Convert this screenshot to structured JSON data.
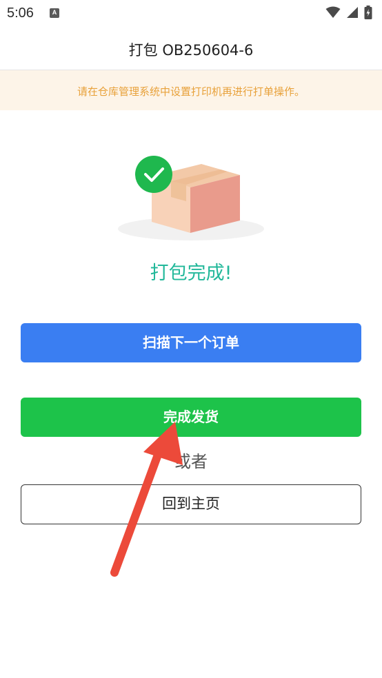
{
  "status": {
    "time": "5:06",
    "notification_icon": "A",
    "icons": [
      "wifi-icon",
      "signal-icon",
      "battery-charging-icon"
    ]
  },
  "header": {
    "title": "打包 OB250604-6"
  },
  "notice": {
    "text": "请在仓库管理系统中设置打印机再进行打单操作。",
    "color": "#e8a13a",
    "background": "#fdf4e8"
  },
  "result": {
    "illustration": "package-done-icon",
    "text": "打包完成!"
  },
  "actions": {
    "scan_next_label": "扫描下一个订单",
    "finish_ship_label": "完成发货",
    "or_label": "或者",
    "home_label": "回到主页"
  },
  "colors": {
    "primary_blue": "#3a7ef2",
    "success_green": "#1dc34a",
    "accent_teal": "#22b89a",
    "annotation_red": "#ec4a3a"
  }
}
